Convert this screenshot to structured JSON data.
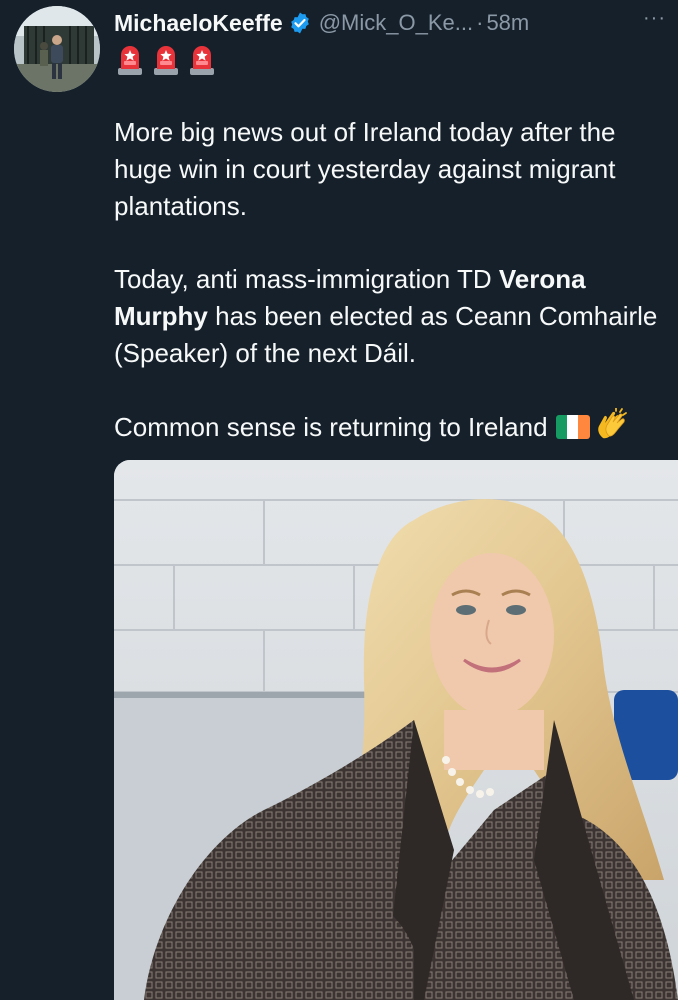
{
  "tweet": {
    "author": {
      "display_name": "MichaeloKeeffe",
      "handle": "@Mick_O_Ke...",
      "verified": true,
      "avatar_icon": "profile-photo"
    },
    "separator": "·",
    "timestamp": "58m",
    "more_icon": "more-horizontal-icon",
    "more_label": "···",
    "bio_emoji": [
      "siren-icon",
      "siren-icon",
      "siren-icon"
    ],
    "paragraph_1": "More big news out of Ireland today after the huge win in court yesterday against migrant plantations.",
    "paragraph_2_prefix": "Today, anti mass-immigration TD ",
    "paragraph_2_bold": "Verona Murphy",
    "paragraph_2_suffix": " has been elected as Ceann Comhairle (Speaker) of the next Dáil.",
    "paragraph_3": "Common sense is returning to Ireland",
    "paragraph_3_emoji": [
      "ireland-flag-icon",
      "clapping-hands-icon"
    ],
    "media": {
      "type": "photo",
      "description_icon": "attached-photo"
    }
  },
  "colors": {
    "background": "#15202b",
    "text_primary": "#f7f9f9",
    "text_secondary": "#8b98a5",
    "verified_blue": "#1d9bf0"
  }
}
